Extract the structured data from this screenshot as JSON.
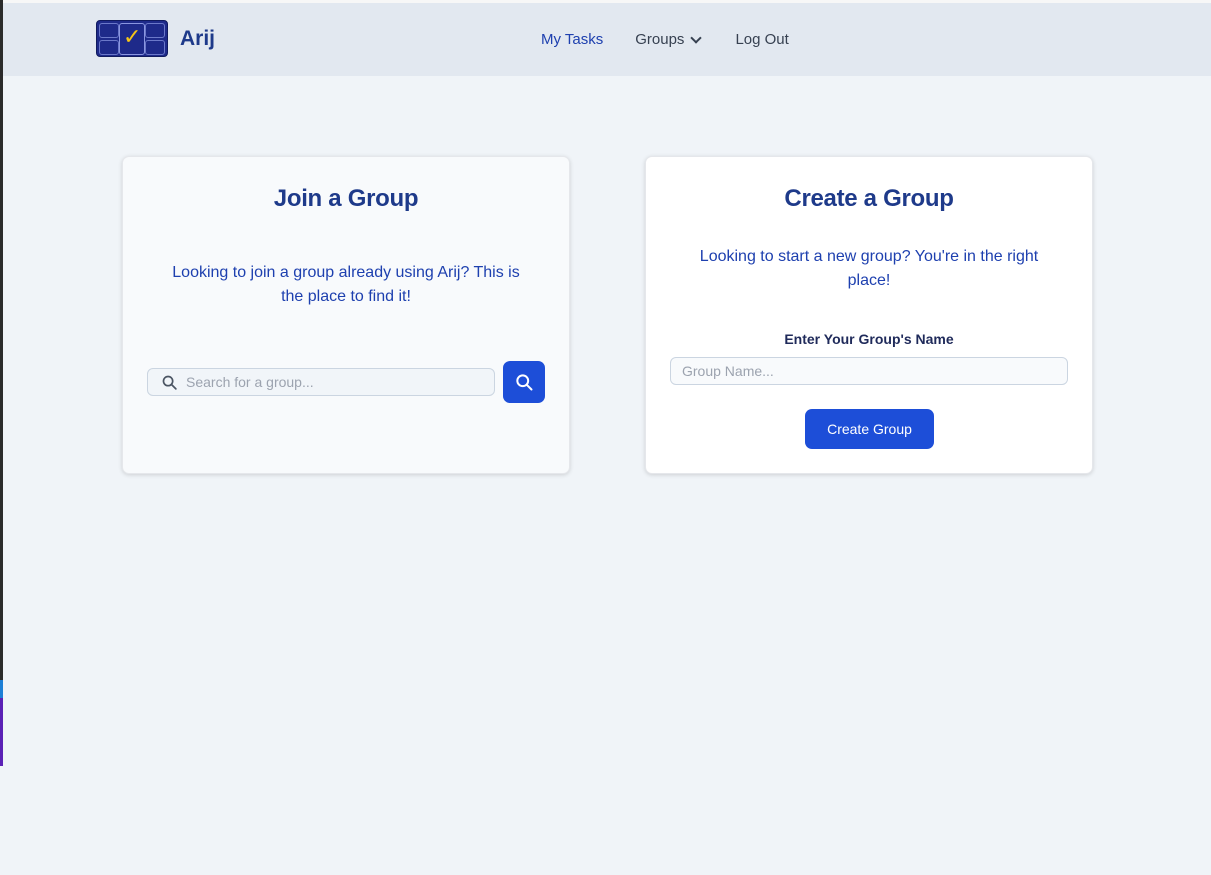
{
  "brand": {
    "name": "Arij",
    "logo_icon": "checkbox-logo-icon"
  },
  "nav": {
    "items": [
      {
        "label": "My Tasks",
        "active": true
      },
      {
        "label": "Groups",
        "has_dropdown": true
      },
      {
        "label": "Log Out"
      }
    ]
  },
  "join": {
    "title": "Join a Group",
    "description": "Looking to join a group already using Arij? This is the place to find it!",
    "search_placeholder": "Search for a group...",
    "search_value": "",
    "search_icon": "search-icon"
  },
  "create": {
    "title": "Create a Group",
    "description": "Looking to start a new group? You're in the right place!",
    "field_label": "Enter Your Group's Name",
    "input_placeholder": "Group Name...",
    "input_value": "",
    "button_label": "Create Group"
  },
  "colors": {
    "accent": "#1d4ed8",
    "heading": "#1e3a8a",
    "navbar_bg": "#e2e8f0",
    "page_bg": "#f0f4f8"
  }
}
